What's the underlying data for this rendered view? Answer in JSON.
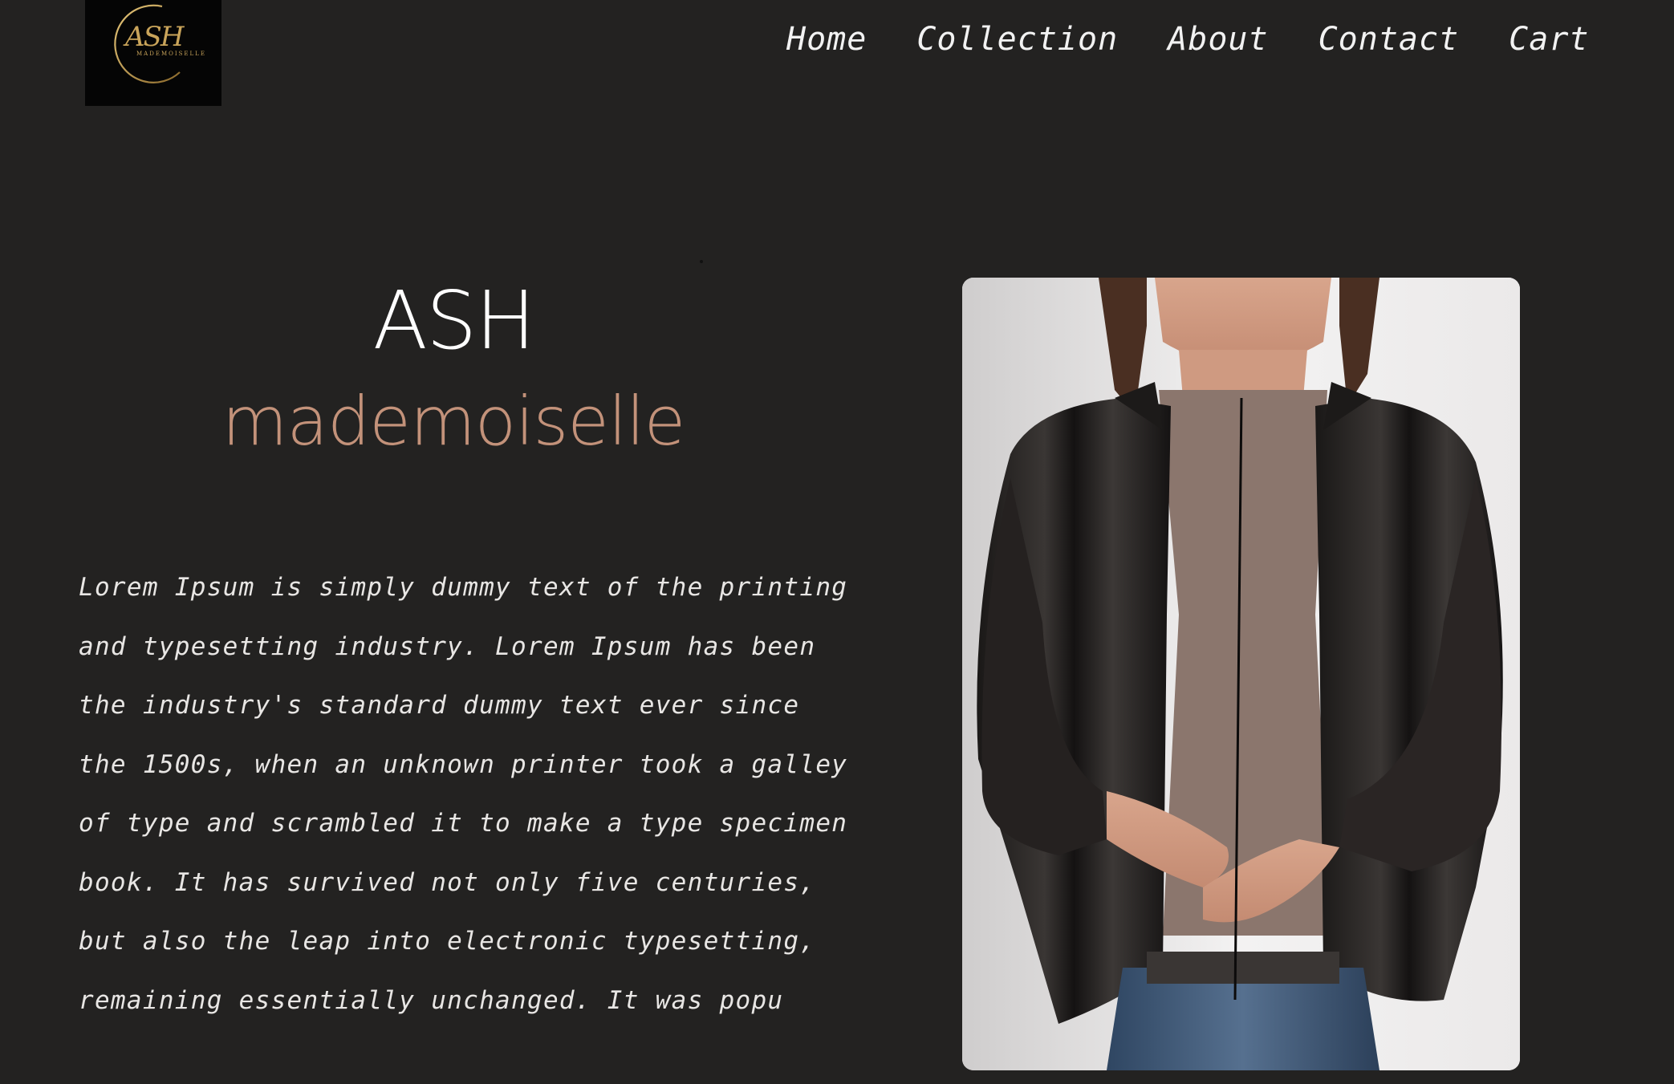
{
  "logo": {
    "monogram": "ASH",
    "wordmark": "MADEMOISELLE",
    "accent_color": "#c9a45a"
  },
  "nav": {
    "items": [
      {
        "label": "Home"
      },
      {
        "label": "Collection"
      },
      {
        "label": "About"
      },
      {
        "label": "Contact"
      },
      {
        "label": "Cart"
      }
    ]
  },
  "hero": {
    "brand_top": "ASH",
    "brand_bottom": "mademoiselle",
    "brand_bottom_color": "#c3927a",
    "intro": "Lorem Ipsum is simply dummy text of the printing and typesetting industry. Lorem Ipsum has been the industry's standard dummy text ever since the 1500s, when an unknown printer took a galley of type and scrambled it to make a type specimen book. It has survived not only five centuries, but also the leap into electronic typesetting, remaining essentially unchanged. It was popu"
  },
  "colors": {
    "background": "#232221",
    "text": "#f2f2f2"
  }
}
